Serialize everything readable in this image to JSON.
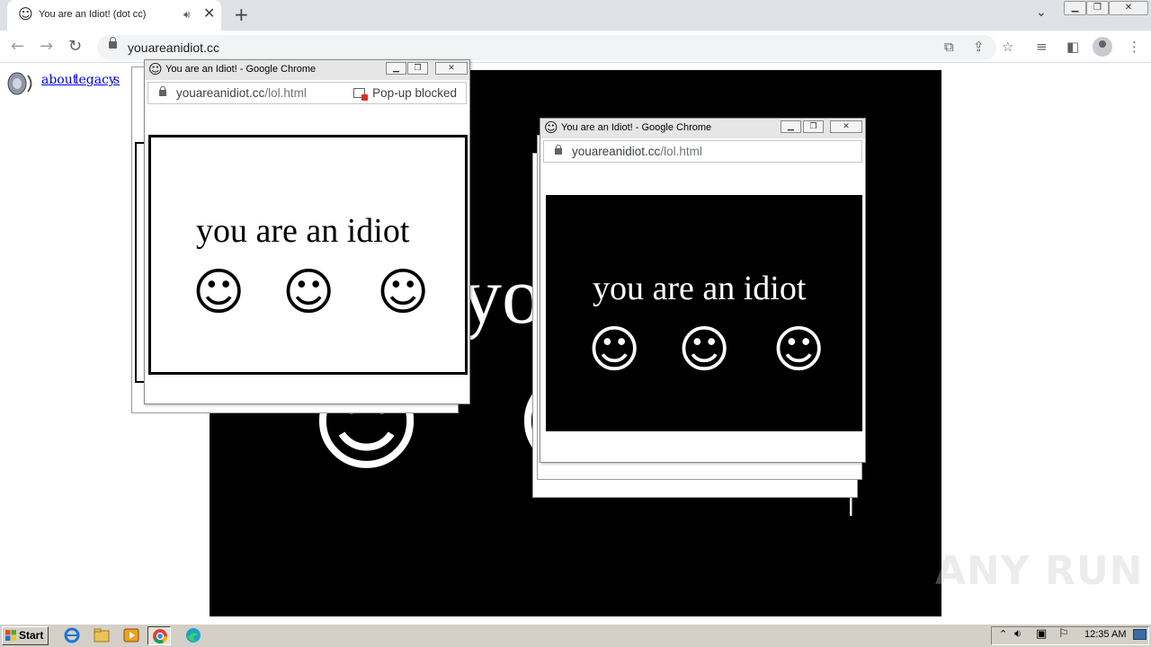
{
  "browser": {
    "tab_title": "You are an Idiot! (dot cc)",
    "address": "youareanidiot.cc",
    "window_controls": [
      "minimize",
      "restore",
      "close"
    ]
  },
  "page": {
    "links": [
      "about",
      "legacy",
      "s"
    ],
    "big_text": "you ar",
    "background_color": "#000000"
  },
  "popups": [
    {
      "title": "You are an Idiot! - Google Chrome",
      "url_host": "youareanidiot.cc",
      "url_path": "/lol.html",
      "notice": "Pop-up blocked",
      "message": "you are an idiot",
      "theme": "white"
    },
    {
      "title": "You are an Idiot! - Google Chrome",
      "url_host": "youareanidiot.cc",
      "url_path": "/lol.html",
      "message": "you are an idiot",
      "theme": "black"
    }
  ],
  "taskbar": {
    "start_label": "Start",
    "clock": "12:35 AM",
    "apps": [
      "internet-explorer-icon",
      "folder-icon",
      "media-player-icon",
      "chrome-icon",
      "edge-icon"
    ]
  },
  "watermark": "ANY RUN"
}
